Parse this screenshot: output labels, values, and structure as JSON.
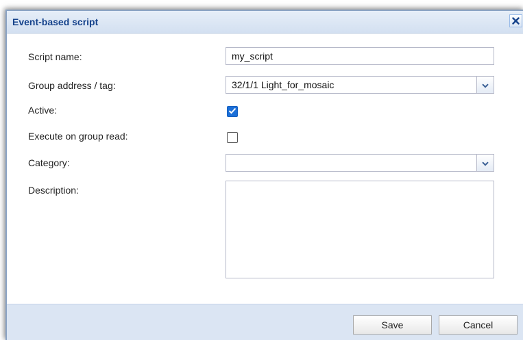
{
  "dialog": {
    "title": "Event-based script",
    "close_icon": "close-icon"
  },
  "form": {
    "script_name": {
      "label": "Script name:",
      "value": "my_script"
    },
    "group_address": {
      "label": "Group address / tag:",
      "value": "32/1/1 Light_for_mosaic"
    },
    "active": {
      "label": "Active:",
      "checked": true
    },
    "execute_on_read": {
      "label": "Execute on group read:",
      "checked": false
    },
    "category": {
      "label": "Category:",
      "value": ""
    },
    "description": {
      "label": "Description:",
      "value": ""
    }
  },
  "footer": {
    "save_label": "Save",
    "cancel_label": "Cancel"
  },
  "colors": {
    "title_text": "#15428b",
    "checkbox_accent": "#1b6fd8",
    "footer_bg": "#dbe5f3"
  }
}
